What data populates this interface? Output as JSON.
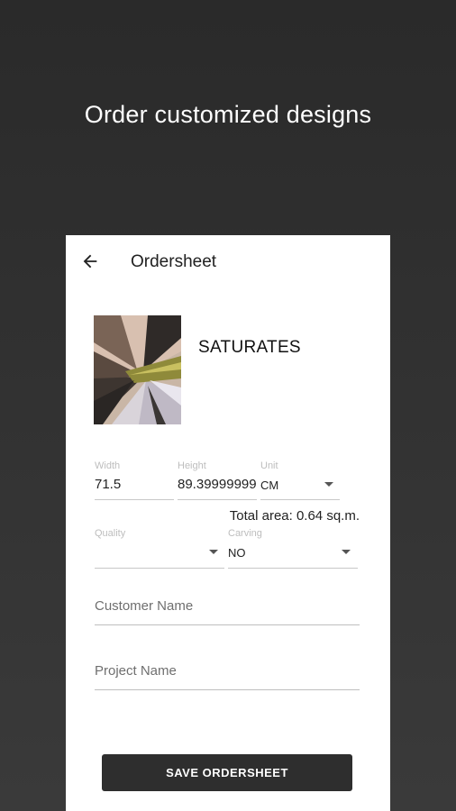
{
  "headline": "Order customized designs",
  "appbar": {
    "title": "Ordersheet",
    "back_icon": "arrow-left-icon"
  },
  "product": {
    "name": "SATURATES",
    "image": "abstract-artwork-thumbnail"
  },
  "dimensions": {
    "width": {
      "label": "Width",
      "value": "71.5"
    },
    "height": {
      "label": "Height",
      "value": "89.39999999"
    },
    "unit": {
      "label": "Unit",
      "value": "CM"
    }
  },
  "total_area": "Total area: 0.64 sq.m.",
  "options": {
    "quality": {
      "label": "Quality",
      "value": ""
    },
    "carving": {
      "label": "Carving",
      "value": "NO"
    }
  },
  "customer_name": {
    "placeholder": "Customer Name"
  },
  "project_name": {
    "placeholder": "Project Name"
  },
  "save_button": "SAVE ORDERSHEET",
  "colors": {
    "background": "#333333",
    "button": "#2e2e2e",
    "card": "#ffffff"
  }
}
